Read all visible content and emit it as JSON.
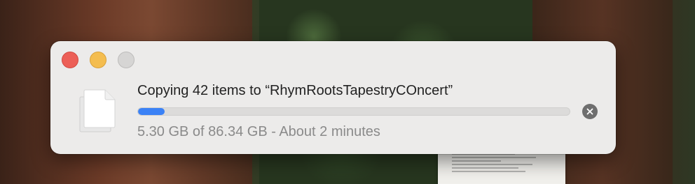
{
  "copy_dialog": {
    "title": "Copying 42 items to “RhymRootsTapestryCOncert”",
    "status": "5.30 GB of 86.34 GB - About 2 minutes",
    "progress_fraction": 0.0614,
    "icons": {
      "file": "document-stack-icon",
      "stop": "stop-x-icon"
    },
    "colors": {
      "progress": "#3b82f6",
      "close_light": "#ec5f57",
      "minimize_light": "#f4bd4f",
      "zoom_light": "#d6d5d4"
    }
  }
}
